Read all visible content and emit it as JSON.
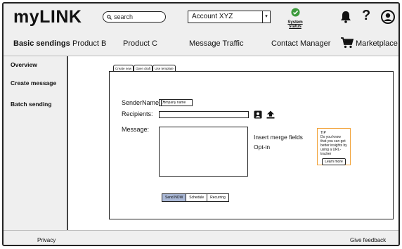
{
  "header": {
    "logo": "myLINK",
    "search_placeholder": "search",
    "account_selected": "Account XYZ",
    "status_label": "System status",
    "icons": [
      "check-circle-icon",
      "bell-icon",
      "help-icon",
      "user-icon"
    ],
    "status_color": "#3c9a3c"
  },
  "nav": {
    "items": [
      {
        "label": "Basic sendings",
        "active": true
      },
      {
        "label": "Product B"
      },
      {
        "label": "Product C"
      },
      {
        "label": "Message Traffic"
      },
      {
        "label": "Contact Manager"
      },
      {
        "label": "Marketplace"
      }
    ]
  },
  "sidebar": {
    "items": [
      {
        "label": "Overview"
      },
      {
        "label": "Create message",
        "active": true
      },
      {
        "label": "Batch sending"
      }
    ]
  },
  "main": {
    "tabs": [
      {
        "label": "Create new",
        "active": true
      },
      {
        "label": "Open draft"
      },
      {
        "label": "Use template"
      }
    ],
    "form": {
      "sender_label": "SenderName:",
      "sender_value": "Company name",
      "recipients_label": "Recipients:",
      "message_label": "Message:"
    },
    "links": {
      "merge_fields": "Insert merge fields",
      "opt_in": "Opt-in"
    },
    "tip": {
      "title": "TIP",
      "text": "Do you know that you can get better insights by using a URL-tracker",
      "button": "Learn more",
      "border_color": "#f2a33a"
    },
    "send_options": [
      {
        "label": "Send NOW",
        "active": true
      },
      {
        "label": "Schedule"
      },
      {
        "label": "Recurring"
      }
    ],
    "active_color": "#aab8d6"
  },
  "footer": {
    "privacy": "Privacy",
    "feedback": "Give feedback"
  }
}
